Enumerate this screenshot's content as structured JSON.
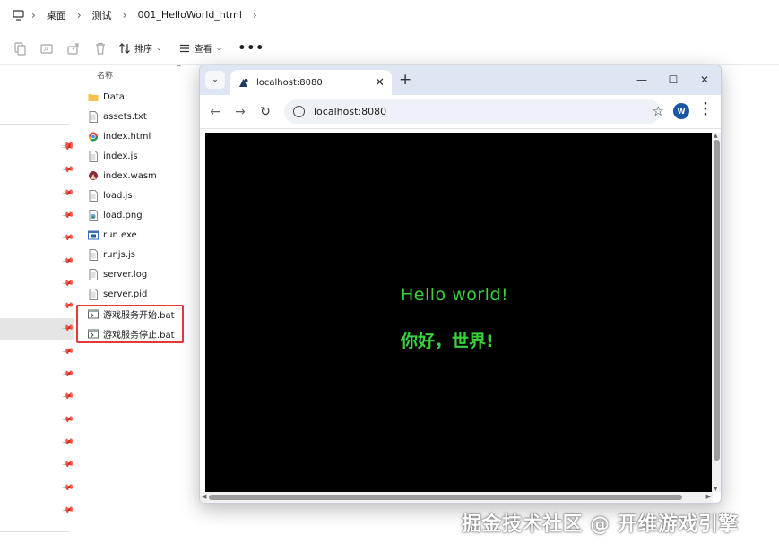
{
  "explorer": {
    "breadcrumb": [
      "桌面",
      "测试",
      "001_HelloWorld_html"
    ],
    "toolbar": {
      "sort_label": "排序",
      "view_label": "查看",
      "more_label": "•••"
    },
    "column_header": "名称",
    "files": [
      {
        "name": "Data",
        "icon": "folder-icon"
      },
      {
        "name": "assets.txt",
        "icon": "text-file-icon"
      },
      {
        "name": "index.html",
        "icon": "chrome-html-icon"
      },
      {
        "name": "index.js",
        "icon": "text-file-icon"
      },
      {
        "name": "index.wasm",
        "icon": "wasm-file-icon"
      },
      {
        "name": "load.js",
        "icon": "text-file-icon"
      },
      {
        "name": "load.png",
        "icon": "image-file-icon"
      },
      {
        "name": "run.exe",
        "icon": "exe-file-icon"
      },
      {
        "name": "runjs.js",
        "icon": "text-file-icon"
      },
      {
        "name": "server.log",
        "icon": "text-file-icon"
      },
      {
        "name": "server.pid",
        "icon": "text-file-icon"
      },
      {
        "name": "游戏服务开始.bat",
        "icon": "bat-file-icon"
      },
      {
        "name": "游戏服务停止.bat",
        "icon": "bat-file-icon"
      }
    ],
    "highlight_color": "#e53935"
  },
  "browser": {
    "tab_title": "localhost:8080",
    "url": "localhost:8080",
    "avatar_initial": "W",
    "avatar_color": "#1a56a6",
    "new_tab_label": "+",
    "content": {
      "line1": "Hello world!",
      "line2": "你好，世界!",
      "text_color": "#36d33a",
      "background": "#000000"
    }
  },
  "watermark": "掘金技术社区 @ 开维游戏引擎"
}
